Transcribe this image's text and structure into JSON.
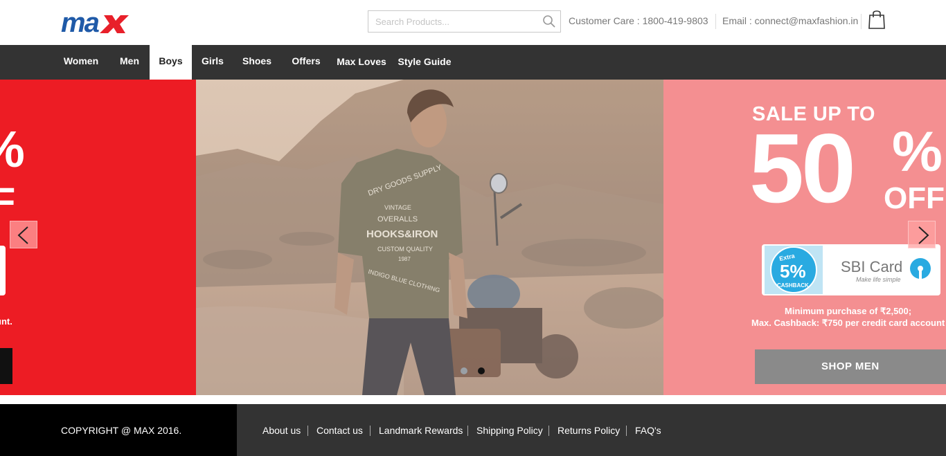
{
  "header": {
    "logo_text": "max",
    "search_placeholder": "Search Products...",
    "customer_care": "Customer Care : 1800-419-9803",
    "email": "Email : connect@maxfashion.in"
  },
  "nav": {
    "items": [
      {
        "label": "Women"
      },
      {
        "label": "Men"
      },
      {
        "label": "Boys",
        "active": true
      },
      {
        "label": "Girls"
      },
      {
        "label": "Shoes"
      },
      {
        "label": "Offers"
      },
      {
        "label": "Max Loves"
      },
      {
        "label": "Style Guide"
      }
    ]
  },
  "banner": {
    "left_partial": {
      "line1": "%",
      "line2": "F",
      "small": "unt."
    },
    "tshirt_print": [
      "DRY GOODS SUPPLY",
      "VINTAGE",
      "OVERALLS",
      "HOOKS&IRON",
      "CUSTOM QUALITY",
      "1987",
      "INDIGO BLUE CLOTHING"
    ],
    "offer": {
      "headline": "SALE UP TO",
      "percent_number": "50",
      "percent_sign": "%",
      "off": "OFF",
      "badge_extra": "Extra",
      "badge_percent": "5%",
      "badge_cashback": "CASHBACK",
      "card_name": "SBI Card",
      "card_tagline": "Make life simple",
      "min_purchase": "Minimum purchase of ₹2,500;",
      "max_cashback": "Max. Cashback: ₹750 per credit card account",
      "cta": "SHOP MEN"
    },
    "slide_count": 2,
    "active_slide": 2
  },
  "footer": {
    "copyright": "COPYRIGHT @ MAX 2016.",
    "links": [
      "About us",
      "Contact us",
      "Landmark Rewards",
      "Shipping Policy",
      "Returns Policy",
      "FAQ's"
    ]
  },
  "colors": {
    "brand_blue": "#1f5aa8",
    "brand_red": "#e8202a",
    "nav_bg": "#333333",
    "promo_red": "#ed1c24",
    "promo_pink": "#f48f91",
    "sbi_blue": "#29aae1"
  }
}
